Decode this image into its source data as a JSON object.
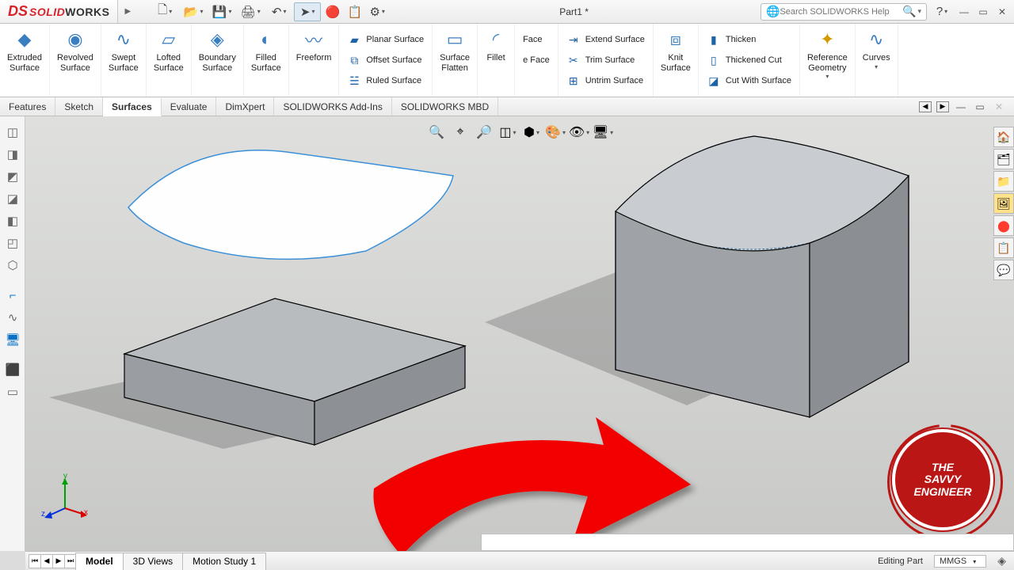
{
  "app": {
    "name_solid": "SOLID",
    "name_works": "WORKS",
    "doc_title": "Part1 *"
  },
  "search": {
    "placeholder": "Search SOLIDWORKS Help"
  },
  "ribbon": {
    "big": [
      {
        "id": "extruded-surface",
        "label": "Extruded\nSurface"
      },
      {
        "id": "revolved-surface",
        "label": "Revolved\nSurface"
      },
      {
        "id": "swept-surface",
        "label": "Swept\nSurface"
      },
      {
        "id": "lofted-surface",
        "label": "Lofted\nSurface"
      },
      {
        "id": "boundary-surface",
        "label": "Boundary\nSurface"
      },
      {
        "id": "filled-surface",
        "label": "Filled\nSurface"
      },
      {
        "id": "freeform",
        "label": "Freeform"
      }
    ],
    "col1": {
      "planar": "Planar Surface",
      "offset": "Offset Surface",
      "ruled": "Ruled Surface"
    },
    "flatten": "Surface\nFlatten",
    "fillet": "Fillet",
    "face_group": {
      "face": "Face",
      "delete_face": "e Face"
    },
    "col2": {
      "extend": "Extend Surface",
      "trim": "Trim Surface",
      "untrim": "Untrim Surface"
    },
    "knit": "Knit\nSurface",
    "col3": {
      "thicken": "Thicken",
      "thickened_cut": "Thickened Cut",
      "cut_with_surface": "Cut With Surface"
    },
    "ref_geom": "Reference\nGeometry",
    "curves": "Curves"
  },
  "tabs": {
    "features": "Features",
    "sketch": "Sketch",
    "surfaces": "Surfaces",
    "evaluate": "Evaluate",
    "dimxpert": "DimXpert",
    "addins": "SOLIDWORKS Add-Ins",
    "mbd": "SOLIDWORKS MBD"
  },
  "bottom_tabs": {
    "model": "Model",
    "views3d": "3D Views",
    "motion": "Motion Study 1"
  },
  "status": {
    "mode": "Editing Part",
    "units": "MMGS"
  },
  "triad": {
    "x": "x",
    "y": "y",
    "z": "z"
  },
  "badge": {
    "line1": "THE",
    "line2": "SAVVY",
    "line3": "ENGINEER"
  }
}
